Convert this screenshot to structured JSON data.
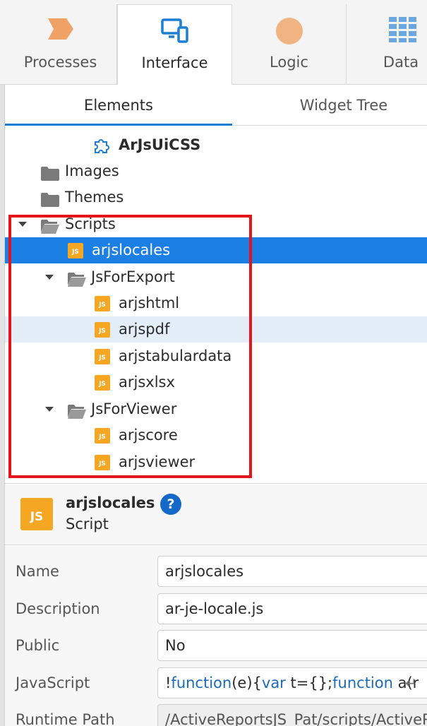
{
  "top_tabs": [
    {
      "label": "Processes",
      "icon": "chevron-shape-icon",
      "color": "#f0a266"
    },
    {
      "label": "Interface",
      "icon": "devices-icon",
      "color": "#1c7fd6"
    },
    {
      "label": "Logic",
      "icon": "circle-icon",
      "color": "#f0b482"
    },
    {
      "label": "Data",
      "icon": "grid-icon",
      "color": "#6aa7e0"
    }
  ],
  "sub_tabs": [
    {
      "label": "Elements"
    },
    {
      "label": "Widget Tree"
    }
  ],
  "tree": {
    "theme_item": "ArJsUiCSS",
    "images_folder": "Images",
    "themes_folder": "Themes",
    "scripts_folder": "Scripts",
    "selected_script": "arjslocales",
    "export_folder": "JsForExport",
    "export_scripts": [
      "arjshtml",
      "arjspdf",
      "arjstabulardata",
      "arjsxlsx"
    ],
    "viewer_folder": "JsForViewer",
    "viewer_scripts": [
      "arjscore",
      "arjsviewer"
    ],
    "js_badge": "JS"
  },
  "info": {
    "name": "arjslocales",
    "kind": "Script",
    "help_glyph": "?",
    "icon_label": "JS"
  },
  "properties": {
    "name_label": "Name",
    "name_value": "arjslocales",
    "description_label": "Description",
    "description_value": "ar-je-locale.js",
    "public_label": "Public",
    "public_value": "No",
    "javascript_label": "JavaScript",
    "javascript_parts": [
      "!",
      "function",
      "(e){",
      "var",
      " t={};",
      "function",
      " a(r"
    ],
    "runtime_label": "Runtime Path",
    "runtime_value": "/ActiveReportsJS_Pat/scripts/ActiveR"
  },
  "colors": {
    "selection": "#1b7fe3",
    "highlight_border": "#e5141a",
    "accent": "#1c7fd6",
    "js_icon": "#f5a623"
  }
}
